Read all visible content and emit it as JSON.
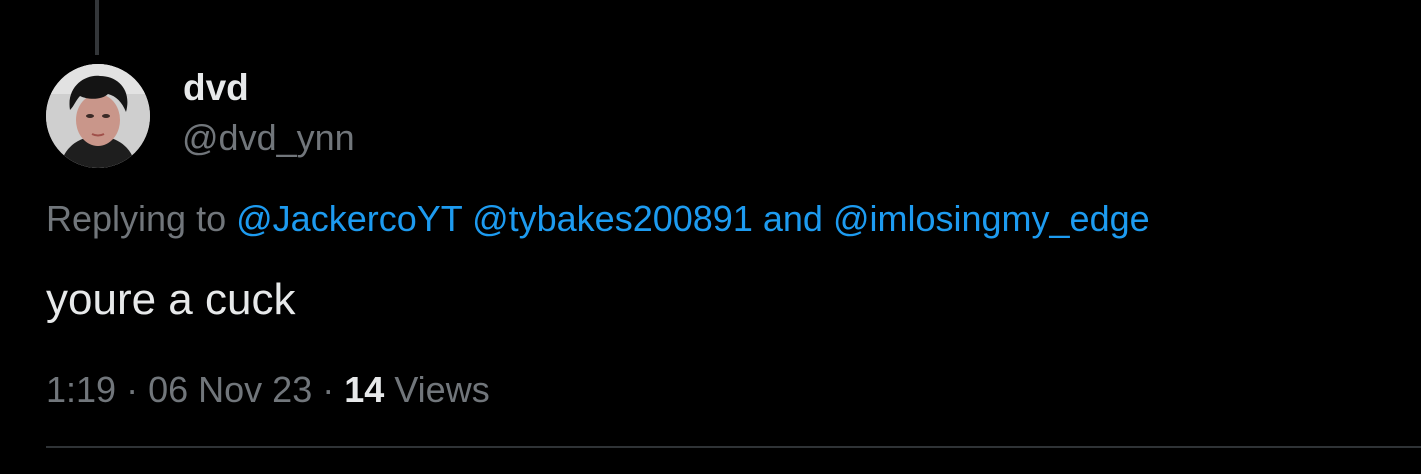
{
  "tweet": {
    "display_name": "dvd",
    "handle": "@dvd_ynn",
    "replying_prefix": "Replying to",
    "mentions": [
      "@JackercoYT",
      "@tybakes200891",
      "@imlosingmy_edge"
    ],
    "mention_joiner": "and",
    "text": "youre a cuck",
    "time": "1:19",
    "separator": "·",
    "date": "06 Nov 23",
    "views_count": "14",
    "views_label": "Views"
  },
  "colors": {
    "background": "#000000",
    "primary_text": "#e7e9ea",
    "secondary_text": "#71767b",
    "link": "#1d9bf0",
    "divider": "#2f3336"
  }
}
